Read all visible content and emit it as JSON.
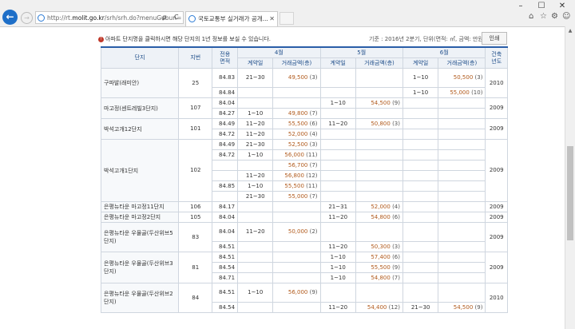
{
  "browser": {
    "address": {
      "prefix": "http://rt.",
      "domain": "molit.go.kr",
      "path": "/srh/srh.do?menuGubun="
    },
    "tab_title": "국토교통부 실거래가 공개...",
    "refresh_label": "C",
    "search_label": "ρ",
    "icons": [
      "home-icon",
      "star-icon",
      "gear-icon",
      "smiley-icon"
    ]
  },
  "notice": "아파트 단지명을 클릭하시면 해당 단지의 1년 정보를 보실 수 있습니다.",
  "basis": "기준 : 2016년 2분기, 단위(면적: ㎡, 금액: 만원)",
  "print_label": "인쇄",
  "table": {
    "headers": {
      "complex": "단지",
      "jibun": "지번",
      "area": "전용\n면적",
      "months": [
        "4월",
        "5월",
        "6월"
      ],
      "contract_day": "계약일",
      "amount": "거래금액(층)",
      "built_year": "건축\n년도"
    },
    "complexes": [
      {
        "name": "구파발(래미안)",
        "jibun": "25",
        "year": "2010",
        "rows": [
          {
            "area": "84.83",
            "m4": [
              "21~30",
              "49,500",
              "(3)"
            ],
            "m5": [
              "",
              "",
              ""
            ],
            "m6": [
              "1~10",
              "50,500",
              "(3)"
            ]
          },
          {
            "area": "84.84",
            "m4": [
              "",
              "",
              ""
            ],
            "m5": [
              "",
              "",
              ""
            ],
            "m6": [
              "1~10",
              "55,000",
              "(10)"
            ]
          }
        ]
      },
      {
        "name": "마고정(센트레빌3단지)",
        "jibun": "107",
        "year": "2009",
        "rows": [
          {
            "area": "84.04",
            "m4": [
              "",
              "",
              ""
            ],
            "m5": [
              "1~10",
              "54,500",
              "(9)"
            ],
            "m6": [
              "",
              "",
              ""
            ]
          },
          {
            "area": "84.27",
            "m4": [
              "1~10",
              "49,800",
              "(7)"
            ],
            "m5": [
              "",
              "",
              ""
            ],
            "m6": [
              "",
              "",
              ""
            ]
          }
        ]
      },
      {
        "name": "박석고개12단지",
        "jibun": "101",
        "year": "2009",
        "rows": [
          {
            "area": "84.49",
            "m4": [
              "11~20",
              "55,500",
              "(6)"
            ],
            "m5": [
              "11~20",
              "50,800",
              "(3)"
            ],
            "m6": [
              "",
              "",
              ""
            ]
          },
          {
            "area": "84.72",
            "m4": [
              "11~20",
              "52,000",
              "(4)"
            ],
            "m5": [
              "",
              "",
              ""
            ],
            "m6": [
              "",
              "",
              ""
            ]
          }
        ]
      },
      {
        "name": "박석고개1단지",
        "jibun": "102",
        "year": "2009",
        "rows": [
          {
            "area": "84.49",
            "m4": [
              "21~30",
              "52,500",
              "(3)"
            ],
            "m5": [
              "",
              "",
              ""
            ],
            "m6": [
              "",
              "",
              ""
            ]
          },
          {
            "area": "84.72",
            "m4": [
              "1~10",
              "56,000",
              "(11)"
            ],
            "m5": [
              "",
              "",
              ""
            ],
            "m6": [
              "",
              "",
              ""
            ]
          },
          {
            "area": "",
            "m4": [
              "",
              "56,700",
              "(7)"
            ],
            "m5": [
              "",
              "",
              ""
            ],
            "m6": [
              "",
              "",
              ""
            ]
          },
          {
            "area": "",
            "m4": [
              "11~20",
              "56,800",
              "(12)"
            ],
            "m5": [
              "",
              "",
              ""
            ],
            "m6": [
              "",
              "",
              ""
            ]
          },
          {
            "area": "84.85",
            "m4": [
              "1~10",
              "55,500",
              "(11)"
            ],
            "m5": [
              "",
              "",
              ""
            ],
            "m6": [
              "",
              "",
              ""
            ]
          },
          {
            "area": "",
            "m4": [
              "21~30",
              "55,000",
              "(7)"
            ],
            "m5": [
              "",
              "",
              ""
            ],
            "m6": [
              "",
              "",
              ""
            ]
          }
        ]
      },
      {
        "name": "은평뉴타운 마고정11단지",
        "jibun": "106",
        "year": "2009",
        "rows": [
          {
            "area": "84.17",
            "m4": [
              "",
              "",
              ""
            ],
            "m5": [
              "21~31",
              "52,000",
              "(4)"
            ],
            "m6": [
              "",
              "",
              ""
            ]
          }
        ]
      },
      {
        "name": "은평뉴타운 마고정2단지",
        "jibun": "105",
        "year": "2009",
        "rows": [
          {
            "area": "84.04",
            "m4": [
              "",
              "",
              ""
            ],
            "m5": [
              "11~20",
              "54,800",
              "(6)"
            ],
            "m6": [
              "",
              "",
              ""
            ]
          }
        ]
      },
      {
        "name": "은평뉴타운 우물골(두산위브5단지)",
        "jibun": "83",
        "year": "2009",
        "rows": [
          {
            "area": "84.04",
            "m4": [
              "11~20",
              "50,000",
              "(2)"
            ],
            "m5": [
              "",
              "",
              ""
            ],
            "m6": [
              "",
              "",
              ""
            ]
          },
          {
            "area": "84.51",
            "m4": [
              "",
              "",
              ""
            ],
            "m5": [
              "11~20",
              "50,300",
              "(3)"
            ],
            "m6": [
              "",
              "",
              ""
            ]
          }
        ]
      },
      {
        "name": "은평뉴타운 우물골(두산위브3단지)",
        "jibun": "81",
        "year": "2009",
        "rows": [
          {
            "area": "84.51",
            "m4": [
              "",
              "",
              ""
            ],
            "m5": [
              "1~10",
              "57,400",
              "(6)"
            ],
            "m6": [
              "",
              "",
              ""
            ]
          },
          {
            "area": "84.54",
            "m4": [
              "",
              "",
              ""
            ],
            "m5": [
              "1~10",
              "55,500",
              "(9)"
            ],
            "m6": [
              "",
              "",
              ""
            ]
          },
          {
            "area": "84.71",
            "m4": [
              "",
              "",
              ""
            ],
            "m5": [
              "1~10",
              "54,800",
              "(7)"
            ],
            "m6": [
              "",
              "",
              ""
            ]
          }
        ]
      },
      {
        "name": "은평뉴타운 우물골(두산위브2단지)",
        "jibun": "84",
        "year": "2010",
        "rows": [
          {
            "area": "84.51",
            "m4": [
              "1~10",
              "56,000",
              "(9)"
            ],
            "m5": [
              "",
              "",
              ""
            ],
            "m6": [
              "",
              "",
              ""
            ]
          },
          {
            "area": "84.54",
            "m4": [
              "",
              "",
              ""
            ],
            "m5": [
              "11~20",
              "54,400",
              "(12)"
            ],
            "m6": [
              "21~30",
              "54,500",
              "(9)"
            ]
          }
        ]
      }
    ]
  }
}
